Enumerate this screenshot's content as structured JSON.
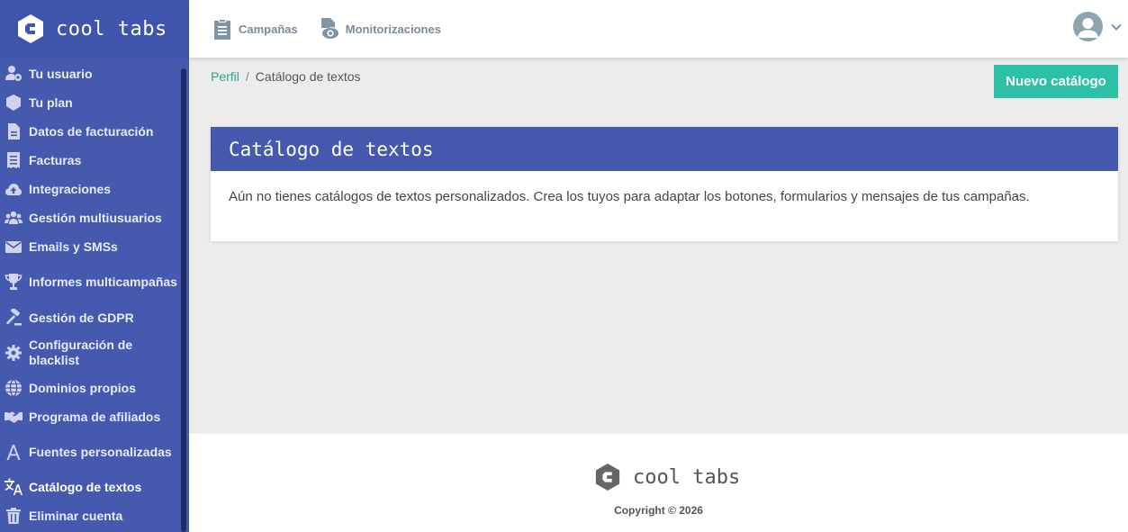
{
  "brand": {
    "name": "cool tabs"
  },
  "topnav": [
    {
      "label": "Campañas",
      "icon": "clipboard-icon"
    },
    {
      "label": "Monitorizaciones",
      "icon": "eye-document-icon"
    }
  ],
  "sidebar": {
    "items": [
      {
        "label": "Tu usuario",
        "icon": "user-cog-icon"
      },
      {
        "label": "Tu plan",
        "icon": "box-icon"
      },
      {
        "label": "Datos de facturación",
        "icon": "file-icon"
      },
      {
        "label": "Facturas",
        "icon": "receipt-icon"
      },
      {
        "label": "Integraciones",
        "icon": "cloud-upload-icon"
      },
      {
        "label": "Gestión multiusuarios",
        "icon": "users-icon"
      },
      {
        "label": "Emails y SMSs",
        "icon": "envelope-icon"
      },
      {
        "label": "Informes multicampañas",
        "icon": "trophy-icon"
      },
      {
        "label": "Gestión de GDPR",
        "icon": "gavel-icon"
      },
      {
        "label": "Configuración de blacklist",
        "icon": "gear-icon"
      },
      {
        "label": "Dominios propios",
        "icon": "globe-icon"
      },
      {
        "label": "Programa de afiliados",
        "icon": "handshake-icon"
      },
      {
        "label": "Fuentes personalizadas",
        "icon": "font-icon"
      },
      {
        "label": "Catálogo de textos",
        "icon": "language-icon",
        "active": true
      },
      {
        "label": "Eliminar cuenta",
        "icon": "trash-icon"
      }
    ]
  },
  "breadcrumb": {
    "link": "Perfil",
    "separator": "/",
    "current": "Catálogo de textos"
  },
  "actions": {
    "new_catalog": "Nuevo catálogo"
  },
  "card": {
    "title": "Catálogo de textos",
    "body": "Aún no tienes catálogos de textos personalizados. Crea los tuyos para adaptar los botones, formularios y mensajes de tus campañas."
  },
  "footer": {
    "brand": "cool tabs",
    "copyright": "Copyright © 2026"
  },
  "colors": {
    "primary": "#4559ae",
    "accent": "#2cc0a6",
    "link": "#2aa690"
  }
}
